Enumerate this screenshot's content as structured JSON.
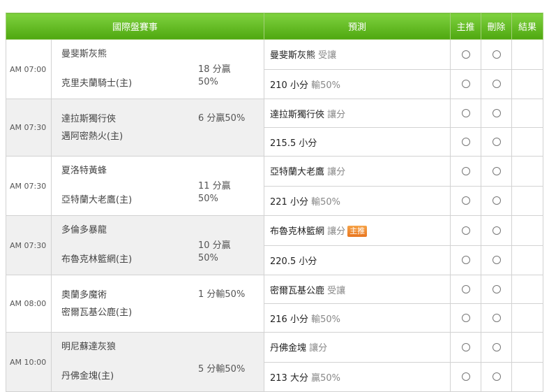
{
  "header": {
    "game": "國際盤賽事",
    "prediction": "預測",
    "main_pick": "主推",
    "delete": "刪除",
    "result": "結果"
  },
  "badge": "主推",
  "games": [
    {
      "time": "AM 07:00",
      "away": "曼斐斯灰熊",
      "home": "克里夫蘭騎士(主)",
      "odds_line1": "18 分贏",
      "odds_line2": "50%",
      "pred1_team": "曼斐斯灰熊",
      "pred1_type": "受讓",
      "pred2_main": "210 小分",
      "pred2_sub": "輸50%"
    },
    {
      "time": "AM 07:30",
      "away": "達拉斯獨行俠",
      "home": "邁阿密熱火(主)",
      "odds_line1": "6 分贏50%",
      "pred1_team": "達拉斯獨行俠",
      "pred1_type": "讓分",
      "pred2_main": "215.5 小分",
      "pred2_sub": ""
    },
    {
      "time": "AM 07:30",
      "away": "夏洛特黃蜂",
      "home": "亞特蘭大老鷹(主)",
      "odds_line1": "11 分贏",
      "odds_line2": "50%",
      "pred1_team": "亞特蘭大老鷹",
      "pred1_type": "讓分",
      "pred2_main": "221 小分",
      "pred2_sub": "輸50%"
    },
    {
      "time": "AM 07:30",
      "away": "多倫多暴龍",
      "home": "布魯克林籃網(主)",
      "odds_line1": "10 分贏",
      "odds_line2": "50%",
      "pred1_team": "布魯克林籃網",
      "pred1_type": "讓分",
      "pred2_main": "220.5 小分",
      "pred2_sub": ""
    },
    {
      "time": "AM 08:00",
      "away": "奧蘭多魔術",
      "home": "密爾瓦基公鹿(主)",
      "odds_line1": "1 分輸50%",
      "pred1_team": "密爾瓦基公鹿",
      "pred1_type": "受讓",
      "pred2_main": "216 小分",
      "pred2_sub": "輸50%"
    },
    {
      "time": "AM 10:00",
      "away": "明尼蘇達灰狼",
      "home": "丹佛金塊(主)",
      "odds_line1": "5 分輸50%",
      "pred1_team": "丹佛金塊",
      "pred1_type": "讓分",
      "pred2_main": "213 大分",
      "pred2_sub": "贏50%"
    }
  ]
}
